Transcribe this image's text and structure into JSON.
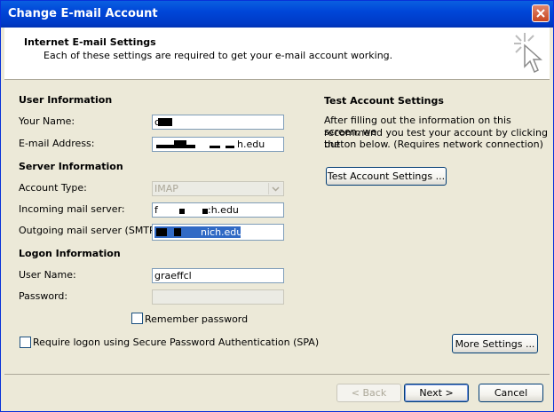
{
  "window": {
    "title": "Change E-mail Account"
  },
  "header": {
    "title": "Internet E-mail Settings",
    "subtitle": "Each of these settings are required to get your e-mail account working."
  },
  "user_information": {
    "heading": "User Information",
    "your_name_label": "Your Name:",
    "your_name_value": "c",
    "email_label": "E-mail Address:",
    "email_value": "h.edu"
  },
  "server_information": {
    "heading": "Server Information",
    "account_type_label": "Account Type:",
    "account_type_value": "IMAP",
    "incoming_label": "Incoming mail server:",
    "incoming_value_prefix": "f",
    "incoming_value_suffix": ":h.edu",
    "outgoing_label": "Outgoing mail server (SMTP):",
    "outgoing_value": "nich.edu"
  },
  "logon_information": {
    "heading": "Logon Information",
    "user_name_label": "User Name:",
    "user_name_value": "graeffcl",
    "password_label": "Password:",
    "password_value": "",
    "remember_password_label": "Remember password",
    "remember_password_checked": false,
    "spa_label": "Require logon using Secure Password Authentication (SPA)",
    "spa_checked": false
  },
  "test_settings": {
    "heading": "Test Account Settings",
    "description_line1": "After filling out the information on this screen, we",
    "description_line2": "recommend you test your account by clicking the",
    "description_line3": "button below. (Requires network connection)",
    "button_label": "Test Account Settings ..."
  },
  "buttons": {
    "more_settings": "More Settings ...",
    "back": "< Back",
    "next": "Next >",
    "cancel": "Cancel"
  },
  "icons": {
    "close": "close-icon",
    "header_graphic": "sparkle-cursor-icon",
    "dropdown": "chevron-down-icon"
  },
  "colors": {
    "titlebar": "#0046d8",
    "dialog_bg": "#ece9d8",
    "selection": "#316ac5"
  }
}
